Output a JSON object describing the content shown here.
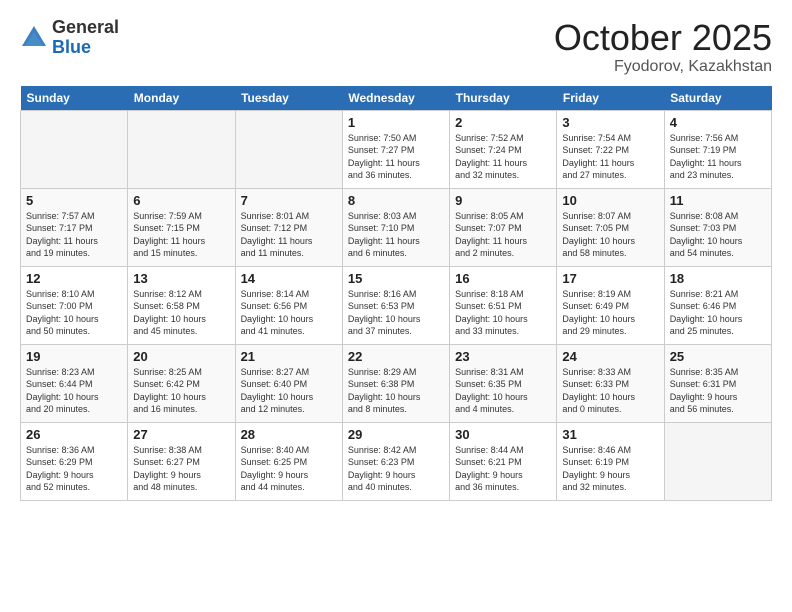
{
  "logo": {
    "general": "General",
    "blue": "Blue"
  },
  "header": {
    "month": "October 2025",
    "location": "Fyodorov, Kazakhstan"
  },
  "weekdays": [
    "Sunday",
    "Monday",
    "Tuesday",
    "Wednesday",
    "Thursday",
    "Friday",
    "Saturday"
  ],
  "weeks": [
    [
      {
        "day": "",
        "info": ""
      },
      {
        "day": "",
        "info": ""
      },
      {
        "day": "",
        "info": ""
      },
      {
        "day": "1",
        "info": "Sunrise: 7:50 AM\nSunset: 7:27 PM\nDaylight: 11 hours\nand 36 minutes."
      },
      {
        "day": "2",
        "info": "Sunrise: 7:52 AM\nSunset: 7:24 PM\nDaylight: 11 hours\nand 32 minutes."
      },
      {
        "day": "3",
        "info": "Sunrise: 7:54 AM\nSunset: 7:22 PM\nDaylight: 11 hours\nand 27 minutes."
      },
      {
        "day": "4",
        "info": "Sunrise: 7:56 AM\nSunset: 7:19 PM\nDaylight: 11 hours\nand 23 minutes."
      }
    ],
    [
      {
        "day": "5",
        "info": "Sunrise: 7:57 AM\nSunset: 7:17 PM\nDaylight: 11 hours\nand 19 minutes."
      },
      {
        "day": "6",
        "info": "Sunrise: 7:59 AM\nSunset: 7:15 PM\nDaylight: 11 hours\nand 15 minutes."
      },
      {
        "day": "7",
        "info": "Sunrise: 8:01 AM\nSunset: 7:12 PM\nDaylight: 11 hours\nand 11 minutes."
      },
      {
        "day": "8",
        "info": "Sunrise: 8:03 AM\nSunset: 7:10 PM\nDaylight: 11 hours\nand 6 minutes."
      },
      {
        "day": "9",
        "info": "Sunrise: 8:05 AM\nSunset: 7:07 PM\nDaylight: 11 hours\nand 2 minutes."
      },
      {
        "day": "10",
        "info": "Sunrise: 8:07 AM\nSunset: 7:05 PM\nDaylight: 10 hours\nand 58 minutes."
      },
      {
        "day": "11",
        "info": "Sunrise: 8:08 AM\nSunset: 7:03 PM\nDaylight: 10 hours\nand 54 minutes."
      }
    ],
    [
      {
        "day": "12",
        "info": "Sunrise: 8:10 AM\nSunset: 7:00 PM\nDaylight: 10 hours\nand 50 minutes."
      },
      {
        "day": "13",
        "info": "Sunrise: 8:12 AM\nSunset: 6:58 PM\nDaylight: 10 hours\nand 45 minutes."
      },
      {
        "day": "14",
        "info": "Sunrise: 8:14 AM\nSunset: 6:56 PM\nDaylight: 10 hours\nand 41 minutes."
      },
      {
        "day": "15",
        "info": "Sunrise: 8:16 AM\nSunset: 6:53 PM\nDaylight: 10 hours\nand 37 minutes."
      },
      {
        "day": "16",
        "info": "Sunrise: 8:18 AM\nSunset: 6:51 PM\nDaylight: 10 hours\nand 33 minutes."
      },
      {
        "day": "17",
        "info": "Sunrise: 8:19 AM\nSunset: 6:49 PM\nDaylight: 10 hours\nand 29 minutes."
      },
      {
        "day": "18",
        "info": "Sunrise: 8:21 AM\nSunset: 6:46 PM\nDaylight: 10 hours\nand 25 minutes."
      }
    ],
    [
      {
        "day": "19",
        "info": "Sunrise: 8:23 AM\nSunset: 6:44 PM\nDaylight: 10 hours\nand 20 minutes."
      },
      {
        "day": "20",
        "info": "Sunrise: 8:25 AM\nSunset: 6:42 PM\nDaylight: 10 hours\nand 16 minutes."
      },
      {
        "day": "21",
        "info": "Sunrise: 8:27 AM\nSunset: 6:40 PM\nDaylight: 10 hours\nand 12 minutes."
      },
      {
        "day": "22",
        "info": "Sunrise: 8:29 AM\nSunset: 6:38 PM\nDaylight: 10 hours\nand 8 minutes."
      },
      {
        "day": "23",
        "info": "Sunrise: 8:31 AM\nSunset: 6:35 PM\nDaylight: 10 hours\nand 4 minutes."
      },
      {
        "day": "24",
        "info": "Sunrise: 8:33 AM\nSunset: 6:33 PM\nDaylight: 10 hours\nand 0 minutes."
      },
      {
        "day": "25",
        "info": "Sunrise: 8:35 AM\nSunset: 6:31 PM\nDaylight: 9 hours\nand 56 minutes."
      }
    ],
    [
      {
        "day": "26",
        "info": "Sunrise: 8:36 AM\nSunset: 6:29 PM\nDaylight: 9 hours\nand 52 minutes."
      },
      {
        "day": "27",
        "info": "Sunrise: 8:38 AM\nSunset: 6:27 PM\nDaylight: 9 hours\nand 48 minutes."
      },
      {
        "day": "28",
        "info": "Sunrise: 8:40 AM\nSunset: 6:25 PM\nDaylight: 9 hours\nand 44 minutes."
      },
      {
        "day": "29",
        "info": "Sunrise: 8:42 AM\nSunset: 6:23 PM\nDaylight: 9 hours\nand 40 minutes."
      },
      {
        "day": "30",
        "info": "Sunrise: 8:44 AM\nSunset: 6:21 PM\nDaylight: 9 hours\nand 36 minutes."
      },
      {
        "day": "31",
        "info": "Sunrise: 8:46 AM\nSunset: 6:19 PM\nDaylight: 9 hours\nand 32 minutes."
      },
      {
        "day": "",
        "info": ""
      }
    ]
  ]
}
